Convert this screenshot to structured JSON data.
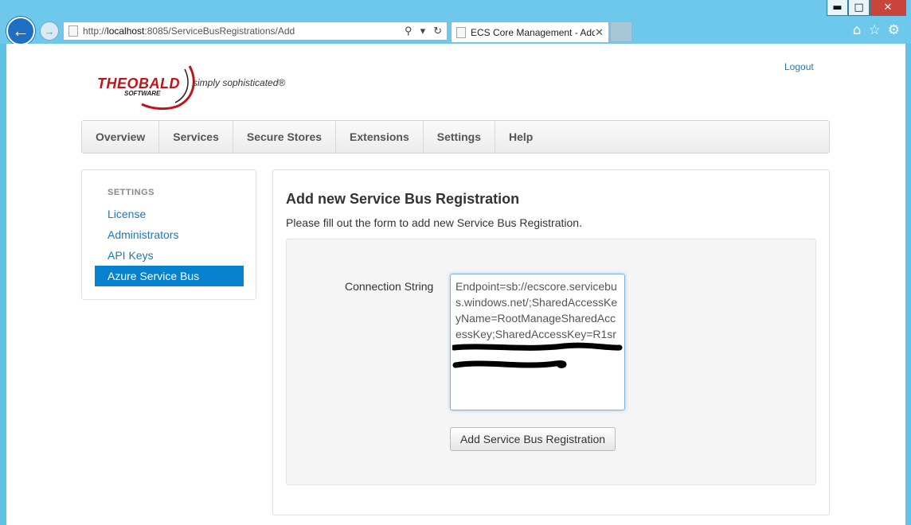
{
  "browser": {
    "url_prefix": "http://",
    "url_host": "localhost",
    "url_rest": ":8085/ServiceBusRegistrations/Add",
    "tab_title": "ECS Core Management - Add",
    "icons": [
      "back-arrow-icon",
      "forward-arrow-icon",
      "search-icon",
      "refresh-icon",
      "home-icon",
      "favorites-star-icon",
      "settings-gear-icon"
    ]
  },
  "header": {
    "logout_label": "Logout",
    "logo_name": "THEOBALD",
    "logo_sub": "SOFTWARE",
    "logo_tagline": "simply sophisticated®"
  },
  "nav": {
    "items": [
      "Overview",
      "Services",
      "Secure Stores",
      "Extensions",
      "Settings",
      "Help"
    ]
  },
  "sidebar": {
    "heading": "SETTINGS",
    "items": [
      {
        "label": "License",
        "active": false
      },
      {
        "label": "Administrators",
        "active": false
      },
      {
        "label": "API Keys",
        "active": false
      },
      {
        "label": "Azure Service Bus",
        "active": true
      }
    ]
  },
  "main": {
    "title": "Add new Service Bus Registration",
    "description": "Please fill out the form to add new Service Bus Registration.",
    "form": {
      "connection_label": "Connection String",
      "connection_value": "Endpoint=sb://ecscore.servicebus.windows.net/;SharedAccessKeyName=RootManageSharedAccessKey;SharedAccessKey=R1sr",
      "submit_label": "Add Service Bus Registration"
    }
  },
  "colors": {
    "accent": "#0581ce",
    "link": "#1f78b4",
    "logo_red": "#c0141b"
  }
}
